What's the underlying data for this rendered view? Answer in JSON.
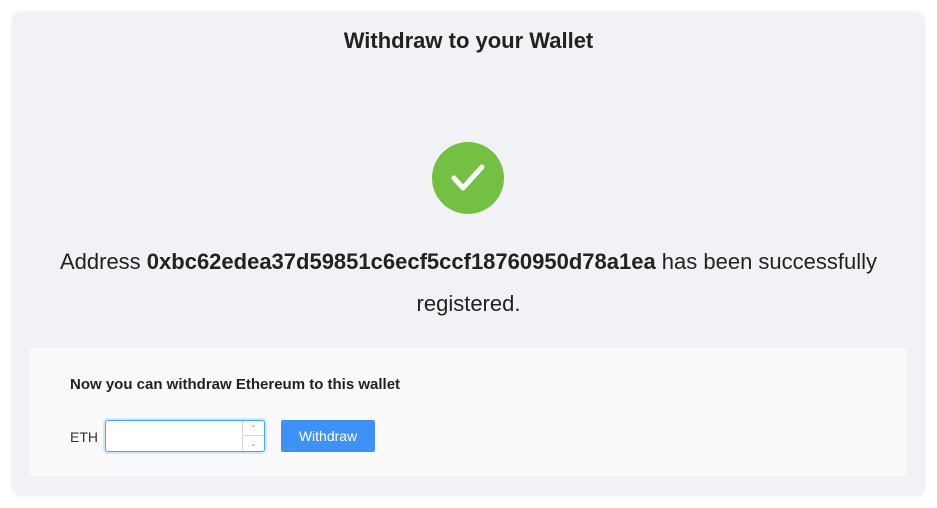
{
  "header": {
    "title": "Withdraw to your Wallet"
  },
  "status": {
    "icon": "checkmark-circle-icon",
    "color": "#73c043",
    "prefix": "Address ",
    "address": "0xbc62edea37d59851c6ecf5ccf18760950d78a1ea",
    "suffix": " has been successfully registered."
  },
  "withdraw_panel": {
    "heading": "Now you can withdraw Ethereum to this wallet",
    "currency_label": "ETH",
    "amount_value": "",
    "amount_placeholder": "",
    "stepper_up_icon": "chevron-up-icon",
    "stepper_down_icon": "chevron-down-icon",
    "button_label": "Withdraw",
    "button_color": "#3d91f7"
  }
}
